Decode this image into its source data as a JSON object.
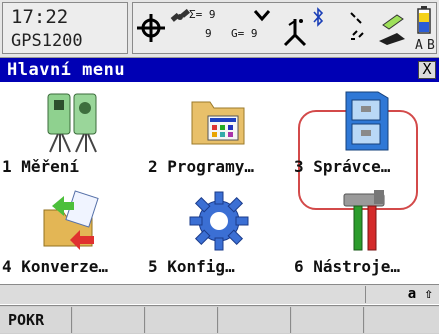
{
  "status": {
    "time": "17:22",
    "device": "GPS1200",
    "gps_pos_label": "Σ= 9",
    "gps_pos_count": "9",
    "glonass_label": "G= 9",
    "track_label": "9",
    "memory_a": "A",
    "memory_b": "B",
    "icons": [
      "position-target-icon",
      "satellite-icon",
      "receiver-icon",
      "bluetooth-icon",
      "radio-icon",
      "sdcard-icon",
      "battery-icon"
    ]
  },
  "window": {
    "title": "Hlavní menu",
    "close": "X"
  },
  "menu": {
    "items": [
      {
        "label": "1 Měření",
        "icon": "surveying-instruments-icon"
      },
      {
        "label": "2 Programy…",
        "icon": "programs-folder-icon"
      },
      {
        "label": "3 Správce…",
        "icon": "file-cabinet-icon"
      },
      {
        "label": "4 Konverze…",
        "icon": "data-convert-icon"
      },
      {
        "label": "5 Konfig…",
        "icon": "config-gear-icon"
      },
      {
        "label": "6 Nástroje…",
        "icon": "tools-icon"
      }
    ],
    "selected_index": 2
  },
  "modebar": {
    "input_mode": "a ⇧"
  },
  "fkeys": [
    "POKR",
    "",
    "",
    "",
    "",
    ""
  ],
  "colors": {
    "title_bg": "#0000b4",
    "selection": "#d34a4a"
  }
}
